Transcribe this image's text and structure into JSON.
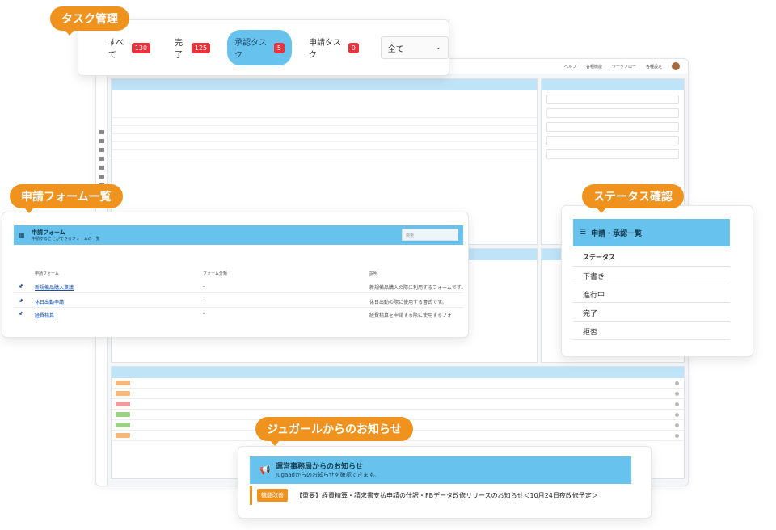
{
  "badges": {
    "task": "タスク管理",
    "forms": "申請フォーム一覧",
    "status": "ステータス確認",
    "notice": "ジュガールからのお知らせ"
  },
  "task_tabs": [
    {
      "label": "すべて",
      "count": "130"
    },
    {
      "label": "完了",
      "count": "125"
    },
    {
      "label": "承認タスク",
      "count": "5"
    },
    {
      "label": "申請タスク",
      "count": "0"
    }
  ],
  "task_filter": {
    "value": "全て"
  },
  "form_panel": {
    "title": "申請フォーム",
    "subtitle": "申請することができるフォームの一覧",
    "search_placeholder": "検索",
    "columns": {
      "form": "申請フォーム",
      "category": "フォーム分類",
      "description": "説明"
    },
    "rows": [
      {
        "name": "新規備品購入稟議",
        "category": "-",
        "description": "新規備品購入の際に利用するフォームです。"
      },
      {
        "name": "休日出勤申請",
        "category": "-",
        "description": "休日出勤の際に使用する書式です。"
      },
      {
        "name": "経費精算",
        "category": "-",
        "description": "経費精算を申請する際に使用するフォ"
      }
    ]
  },
  "status_panel": {
    "title": "申請・承認一覧",
    "header": "ステータス",
    "items": [
      "下書き",
      "進行中",
      "完了",
      "拒否"
    ]
  },
  "notice_panel": {
    "title": "運営事務局からのお知らせ",
    "subtitle": "Jugaadからのお知らせを確認できます。",
    "tag": "機能改善",
    "text": "【重要】経費精算・請求書支払申請の仕訳・FBデータ改修リリースのお知らせ＜10月24日夜改修予定＞"
  },
  "app": {
    "topbar_items": [
      "ヘルプ",
      "各種機能",
      "ワークフロー",
      "各種設定"
    ]
  }
}
